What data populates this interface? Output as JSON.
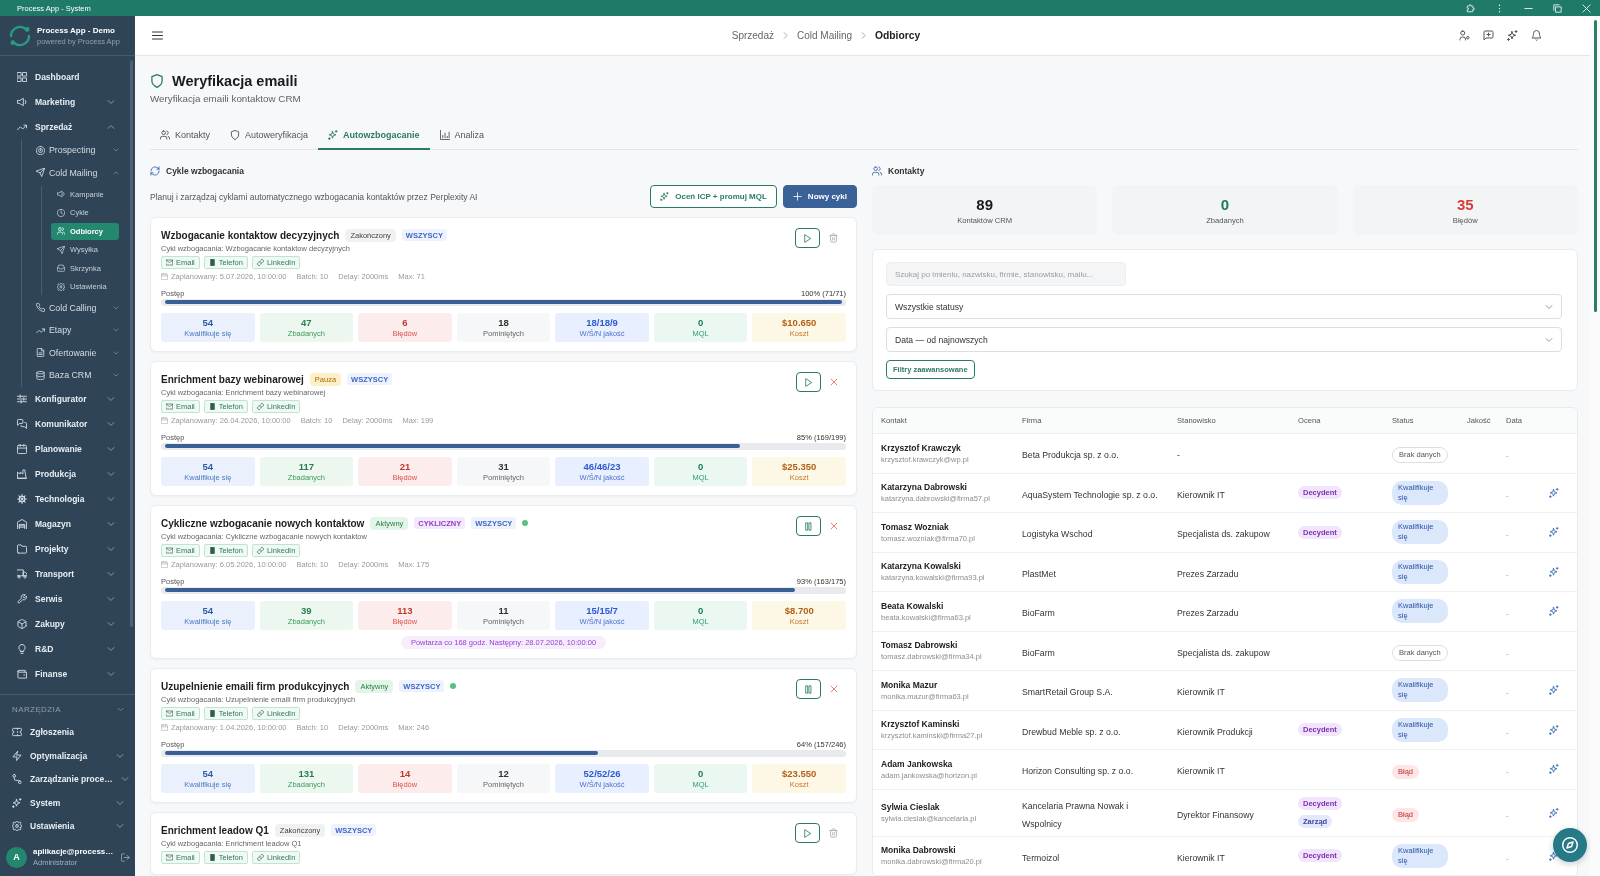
{
  "window": {
    "title": "Process App - System"
  },
  "sidebar": {
    "app_name": "Process App - Demo",
    "app_tagline": "powered by Process App",
    "items": [
      {
        "label": "Dashboard",
        "selected": false
      },
      {
        "label": "Marketing",
        "expanded": false,
        "selected": false
      },
      {
        "label": "Sprzedaż",
        "expanded": true,
        "selected": false,
        "children": [
          {
            "label": "Prospecting",
            "expanded": false,
            "selected": false
          },
          {
            "label": "Cold Mailing",
            "expanded": true,
            "selected": false,
            "children": [
              {
                "label": "Kampanie",
                "selected": false
              },
              {
                "label": "Cykle",
                "selected": false
              },
              {
                "label": "Odbiorcy",
                "selected": true
              },
              {
                "label": "Wysyłka",
                "selected": false
              },
              {
                "label": "Skrzynka",
                "selected": false
              },
              {
                "label": "Ustawienia",
                "selected": false
              }
            ]
          },
          {
            "label": "Cold Calling",
            "expanded": false,
            "selected": false
          },
          {
            "label": "Etapy",
            "expanded": false,
            "selected": false
          },
          {
            "label": "Ofertowanie",
            "expanded": false,
            "selected": false
          },
          {
            "label": "Baza CRM",
            "expanded": false,
            "selected": false
          }
        ]
      },
      {
        "label": "Konfigurator",
        "expanded": false,
        "selected": false
      },
      {
        "label": "Komunikator",
        "expanded": false,
        "selected": false
      },
      {
        "label": "Planowanie",
        "expanded": false,
        "selected": false
      },
      {
        "label": "Produkcja",
        "expanded": false,
        "selected": false
      },
      {
        "label": "Technologia",
        "expanded": false,
        "selected": false
      },
      {
        "label": "Magazyn",
        "expanded": false,
        "selected": false
      },
      {
        "label": "Projekty",
        "expanded": false,
        "selected": false
      },
      {
        "label": "Transport",
        "expanded": false,
        "selected": false
      },
      {
        "label": "Serwis",
        "expanded": false,
        "selected": false
      },
      {
        "label": "Zakupy",
        "expanded": false,
        "selected": false
      },
      {
        "label": "R&D",
        "expanded": false,
        "selected": false
      },
      {
        "label": "Finanse",
        "expanded": false,
        "selected": false
      }
    ],
    "tools": {
      "title": "NARZĘDZIA",
      "items": [
        {
          "label": "Zgłoszenia",
          "selected": false
        },
        {
          "label": "Optymalizacja",
          "expanded": false,
          "selected": false
        },
        {
          "label": "Zarządzanie proce…",
          "expanded": false,
          "selected": false
        },
        {
          "label": "System",
          "expanded": false,
          "selected": false
        },
        {
          "label": "Ustawienia",
          "expanded": false,
          "selected": false
        }
      ]
    },
    "user": {
      "initial": "A",
      "name": "aplikacje@process…",
      "role": "Administrator"
    }
  },
  "header": {
    "breadcrumbs": [
      "Sprzedaż",
      "Cold Mailing",
      "Odbiorcy"
    ]
  },
  "page": {
    "title": "Weryfikacja emaili",
    "subtitle": "Weryfikacja emaili kontaktow CRM"
  },
  "tabs": [
    {
      "label": "Kontakty",
      "selected": false
    },
    {
      "label": "Autoweryfikacja",
      "selected": false
    },
    {
      "label": "Autowzbogacanie",
      "selected": true
    },
    {
      "label": "Analiza",
      "selected": false
    }
  ],
  "cycles": {
    "title": "Cykle wzbogacania",
    "description": "Planuj i zarządzaj cyklami automatycznego wzbogacania kontaktów przez Perplexity AI",
    "actions": [
      {
        "label": "Oceń ICP + promuj MQL",
        "kind": "outline"
      },
      {
        "label": "Nowy cykl",
        "kind": "primary"
      }
    ],
    "items": [
      {
        "title": "Wzbogacanie kontaktow decyzyjnych",
        "status": {
          "text": "Zakończony",
          "kind": "done"
        },
        "tags": [
          {
            "text": "WSZYSCY",
            "kind": "audience"
          }
        ],
        "running": false,
        "subtitle": "Cykl wzbogacania: Wzbogacanie kontaktow decyzyjnych",
        "channels": [
          {
            "label": "Email",
            "kind": "email"
          },
          {
            "label": "Telefon",
            "kind": "phone"
          },
          {
            "label": "LinkedIn",
            "kind": "linkedin"
          }
        ],
        "schedule": "Zaplanowany: 5.07.2026, 10:00:00",
        "meta": [
          "Batch: 10",
          "Delay: 2000ms",
          "Max: 71"
        ],
        "progress": {
          "label": "Postęp",
          "text": "100% (71/71)",
          "level": 1.0
        },
        "stats": [
          {
            "value": "54",
            "label": "Kwalifikuje się",
            "kind": "qualified"
          },
          {
            "value": "47",
            "label": "Zbadanych",
            "kind": "researched"
          },
          {
            "value": "6",
            "label": "Błędów",
            "kind": "errors"
          },
          {
            "value": "18",
            "label": "Pominiętych",
            "kind": "skipped"
          },
          {
            "value": "18/18/9",
            "label": "W/Ś/N jakość",
            "kind": "quality"
          },
          {
            "value": "0",
            "label": "MQL",
            "kind": "mql"
          },
          {
            "value": "$10.650",
            "label": "Koszt",
            "kind": "cost"
          }
        ],
        "buttons": [
          {
            "kind": "play"
          },
          {
            "kind": "delete"
          }
        ]
      },
      {
        "title": "Enrichment bazy webinarowej",
        "status": {
          "text": "Pauza",
          "kind": "paused"
        },
        "tags": [
          {
            "text": "WSZYSCY",
            "kind": "audience"
          }
        ],
        "running": false,
        "subtitle": "Cykl wzbogacania: Enrichment bazy webinarowej",
        "channels": [
          {
            "label": "Email",
            "kind": "email"
          },
          {
            "label": "Telefon",
            "kind": "phone"
          },
          {
            "label": "LinkedIn",
            "kind": "linkedin"
          }
        ],
        "schedule": "Zaplanowany: 26.04.2026, 10:00:00",
        "meta": [
          "Batch: 10",
          "Delay: 2000ms",
          "Max: 199"
        ],
        "progress": {
          "label": "Postęp",
          "text": "85% (169/199)",
          "level": 0.85
        },
        "stats": [
          {
            "value": "54",
            "label": "Kwalifikuje się",
            "kind": "qualified"
          },
          {
            "value": "117",
            "label": "Zbadanych",
            "kind": "researched"
          },
          {
            "value": "21",
            "label": "Błędów",
            "kind": "errors"
          },
          {
            "value": "31",
            "label": "Pominiętych",
            "kind": "skipped"
          },
          {
            "value": "46/46/23",
            "label": "W/Ś/N jakość",
            "kind": "quality"
          },
          {
            "value": "0",
            "label": "MQL",
            "kind": "mql"
          },
          {
            "value": "$25.350",
            "label": "Koszt",
            "kind": "cost"
          }
        ],
        "buttons": [
          {
            "kind": "play"
          },
          {
            "kind": "cancel"
          }
        ]
      },
      {
        "title": "Cykliczne wzbogacanie nowych kontaktow",
        "status": {
          "text": "Aktywny",
          "kind": "active"
        },
        "tags": [
          {
            "text": "CYKLICZNY",
            "kind": "recurring"
          },
          {
            "text": "WSZYSCY",
            "kind": "audience"
          }
        ],
        "running": true,
        "subtitle": "Cykl wzbogacania: Cykliczne wzbogacanie nowych kontaktow",
        "channels": [
          {
            "label": "Email",
            "kind": "email"
          },
          {
            "label": "Telefon",
            "kind": "phone"
          },
          {
            "label": "LinkedIn",
            "kind": "linkedin"
          }
        ],
        "schedule": "Zaplanowany: 6.05.2026, 10:00:00",
        "meta": [
          "Batch: 10",
          "Delay: 2000ms",
          "Max: 175"
        ],
        "progress": {
          "label": "Postęp",
          "text": "93% (163/175)",
          "level": 0.93
        },
        "stats": [
          {
            "value": "54",
            "label": "Kwalifikuje się",
            "kind": "qualified"
          },
          {
            "value": "39",
            "label": "Zbadanych",
            "kind": "researched"
          },
          {
            "value": "113",
            "label": "Błędów",
            "kind": "errors"
          },
          {
            "value": "11",
            "label": "Pominiętych",
            "kind": "skipped"
          },
          {
            "value": "15/15/7",
            "label": "W/Ś/N jakość",
            "kind": "quality"
          },
          {
            "value": "0",
            "label": "MQL",
            "kind": "mql"
          },
          {
            "value": "$8.700",
            "label": "Koszt",
            "kind": "cost"
          }
        ],
        "note": "Powtarza co 168 godz. Następny: 28.07.2026, 10:00:00",
        "buttons": [
          {
            "kind": "pause"
          },
          {
            "kind": "cancel"
          }
        ]
      },
      {
        "title": "Uzupelnienie emaili firm produkcyjnych",
        "status": {
          "text": "Aktywny",
          "kind": "active"
        },
        "tags": [
          {
            "text": "WSZYSCY",
            "kind": "audience"
          }
        ],
        "running": true,
        "subtitle": "Cykl wzbogacania: Uzupelnienie emaili firm produkcyjnych",
        "channels": [
          {
            "label": "Email",
            "kind": "email"
          },
          {
            "label": "Telefon",
            "kind": "phone"
          },
          {
            "label": "LinkedIn",
            "kind": "linkedin"
          }
        ],
        "schedule": "Zaplanowany: 1.04.2026, 10:00:00",
        "meta": [
          "Batch: 10",
          "Delay: 2000ms",
          "Max: 246"
        ],
        "progress": {
          "label": "Postęp",
          "text": "64% (157/246)",
          "level": 0.64
        },
        "stats": [
          {
            "value": "54",
            "label": "Kwalifikuje się",
            "kind": "qualified"
          },
          {
            "value": "131",
            "label": "Zbadanych",
            "kind": "researched"
          },
          {
            "value": "14",
            "label": "Błędów",
            "kind": "errors"
          },
          {
            "value": "12",
            "label": "Pominiętych",
            "kind": "skipped"
          },
          {
            "value": "52/52/26",
            "label": "W/Ś/N jakość",
            "kind": "quality"
          },
          {
            "value": "0",
            "label": "MQL",
            "kind": "mql"
          },
          {
            "value": "$23.550",
            "label": "Koszt",
            "kind": "cost"
          }
        ],
        "buttons": [
          {
            "kind": "pause"
          },
          {
            "kind": "cancel"
          }
        ]
      },
      {
        "title": "Enrichment leadow Q1",
        "status": {
          "text": "Zakończony",
          "kind": "done"
        },
        "tags": [
          {
            "text": "WSZYSCY",
            "kind": "audience"
          }
        ],
        "running": false,
        "subtitle": "Cykl wzbogacania: Enrichment leadow Q1",
        "channels": [
          {
            "label": "Email",
            "kind": "email"
          },
          {
            "label": "Telefon",
            "kind": "phone"
          },
          {
            "label": "LinkedIn",
            "kind": "linkedin"
          }
        ],
        "buttons": [
          {
            "kind": "play"
          },
          {
            "kind": "delete"
          }
        ]
      }
    ]
  },
  "contacts": {
    "title": "Kontakty",
    "stats": [
      {
        "value": "89",
        "label": "Kontaktów CRM",
        "kind": "total"
      },
      {
        "value": "0",
        "label": "Zbadanych",
        "kind": "researched"
      },
      {
        "value": "35",
        "label": "Błędów",
        "kind": "errors"
      }
    ],
    "search": {
      "placeholder": "Szukaj po imieniu, nazwisku, firmie, stanowisku, mailu..."
    },
    "selects": [
      {
        "value": "Wszystkie statusy"
      },
      {
        "value": "Data — od najnowszych"
      }
    ],
    "advanced_filters_button": "Filtry zaawansowane",
    "table": {
      "columns": [
        "Kontakt",
        "Firma",
        "Stanowisko",
        "Ocena",
        "Status",
        "Jakość",
        "Data"
      ],
      "rows": [
        {
          "name": "Krzysztof Krawczyk",
          "email": "krzysztof.krawczyk@wp.pl",
          "company": "Beta Produkcja sp. z o.o.",
          "position": "-",
          "ratings": [],
          "status": {
            "text": "Brak danych",
            "kind": "none"
          },
          "date": "-",
          "enrich": false
        },
        {
          "name": "Katarzyna Dabrowski",
          "email": "katarzyna.dabrowski@firma57.pl",
          "company": "AquaSystem Technologie sp. z o.o.",
          "position": "Kierownik IT",
          "ratings": [
            {
              "text": "Decydent",
              "kind": "decision"
            }
          ],
          "status": {
            "text": "Kwalifikuje się",
            "kind": "qualified"
          },
          "date": "-",
          "enrich": true
        },
        {
          "name": "Tomasz Wozniak",
          "email": "tomasz.wozniak@firma70.pl",
          "company": "Logistyka Wschod",
          "position": "Specjalista ds. zakupow",
          "ratings": [
            {
              "text": "Decydent",
              "kind": "decision"
            }
          ],
          "status": {
            "text": "Kwalifikuje się",
            "kind": "qualified"
          },
          "date": "-",
          "enrich": true
        },
        {
          "name": "Katarzyna Kowalski",
          "email": "katarzyna.kowalski@firma93.pl",
          "company": "PlastMet",
          "position": "Prezes Zarzadu",
          "ratings": [],
          "status": {
            "text": "Kwalifikuje się",
            "kind": "qualified"
          },
          "date": "-",
          "enrich": true
        },
        {
          "name": "Beata Kowalski",
          "email": "beata.kowalski@firma63.pl",
          "company": "BioFarm",
          "position": "Prezes Zarzadu",
          "ratings": [],
          "status": {
            "text": "Kwalifikuje się",
            "kind": "qualified"
          },
          "date": "-",
          "enrich": true
        },
        {
          "name": "Tomasz Dabrowski",
          "email": "tomasz.dabrowski@firma34.pl",
          "company": "BioFarm",
          "position": "Specjalista ds. zakupow",
          "ratings": [],
          "status": {
            "text": "Brak danych",
            "kind": "none"
          },
          "date": "-",
          "enrich": false
        },
        {
          "name": "Monika Mazur",
          "email": "monika.mazur@firma63.pl",
          "company": "SmartRetail Group S.A.",
          "position": "Kierownik IT",
          "ratings": [],
          "status": {
            "text": "Kwalifikuje się",
            "kind": "qualified"
          },
          "date": "-",
          "enrich": true
        },
        {
          "name": "Krzysztof Kaminski",
          "email": "krzysztof.kaminski@firma27.pl",
          "company": "Drewbud Meble sp. z o.o.",
          "position": "Kierownik Produkcji",
          "ratings": [
            {
              "text": "Decydent",
              "kind": "decision"
            }
          ],
          "status": {
            "text": "Kwalifikuje się",
            "kind": "qualified"
          },
          "date": "-",
          "enrich": true
        },
        {
          "name": "Adam Jankowska",
          "email": "adam.jankowska@horizon.pl",
          "company": "Horizon Consulting sp. z o.o.",
          "position": "Kierownik IT",
          "ratings": [],
          "status": {
            "text": "Błąd",
            "kind": "error"
          },
          "date": "-",
          "enrich": true
        },
        {
          "name": "Sylwia Cieslak",
          "email": "sylwia.cieslak@kancelaria.pl",
          "company": "Kancelaria Prawna Nowak i Wspolnicy",
          "position": "Dyrektor Finansowy",
          "ratings": [
            {
              "text": "Decydent",
              "kind": "decision"
            },
            {
              "text": "Zarząd",
              "kind": "board"
            }
          ],
          "status": {
            "text": "Błąd",
            "kind": "error"
          },
          "date": "-",
          "enrich": true
        },
        {
          "name": "Monika Dabrowski",
          "email": "monika.dabrowski@firma20.pl",
          "company": "Termoizol",
          "position": "Kierownik IT",
          "ratings": [
            {
              "text": "Decydent",
              "kind": "decision"
            }
          ],
          "status": {
            "text": "Kwalifikuje się",
            "kind": "qualified"
          },
          "date": "-",
          "enrich": true
        }
      ]
    }
  }
}
